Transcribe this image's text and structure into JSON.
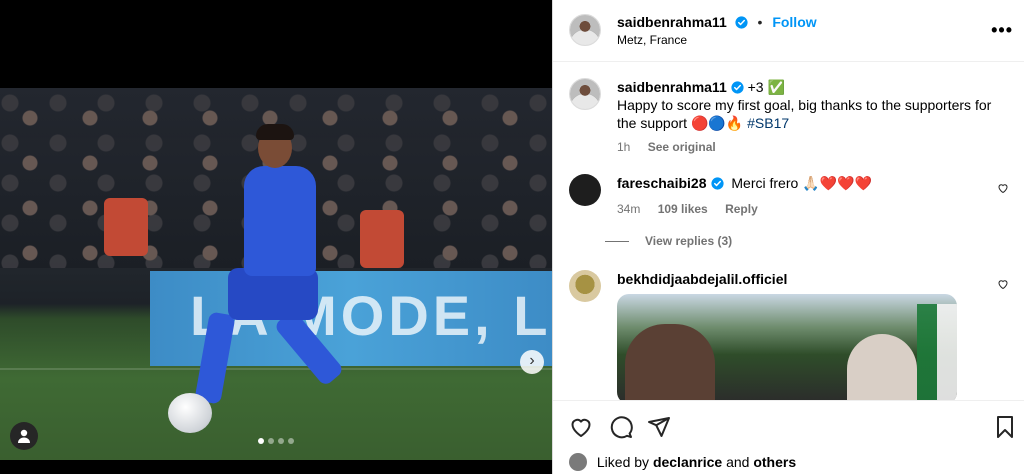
{
  "post": {
    "username": "saidbenrahma11",
    "separator": "•",
    "follow_label": "Follow",
    "location": "Metz, France",
    "more_label": "•••",
    "media_dots": 4,
    "active_dot": 1,
    "board_text": "LA MODE, L"
  },
  "caption": {
    "username": "saidbenrahma11",
    "badge_text": "+3 ✅",
    "text": "Happy to score my first goal, big thanks to the supporters for the support 🔴🔵🔥",
    "hashtag": "#SB17",
    "time": "1h",
    "see_original": "See original"
  },
  "comments": [
    {
      "username": "fareschaibi28",
      "text": "Merci frero 🙏🏻❤️❤️❤️",
      "time": "34m",
      "likes": "109 likes",
      "reply": "Reply",
      "view_replies": "View replies (3)"
    },
    {
      "username": "bekhdidjaabdejalil.officiel",
      "text": ""
    }
  ],
  "liked_by": {
    "prefix": "Liked by",
    "user": "declanrice",
    "and": "and",
    "others": "others"
  },
  "colors": {
    "accent": "#0095f6",
    "verified": "#0095f6",
    "muted": "#737373"
  }
}
